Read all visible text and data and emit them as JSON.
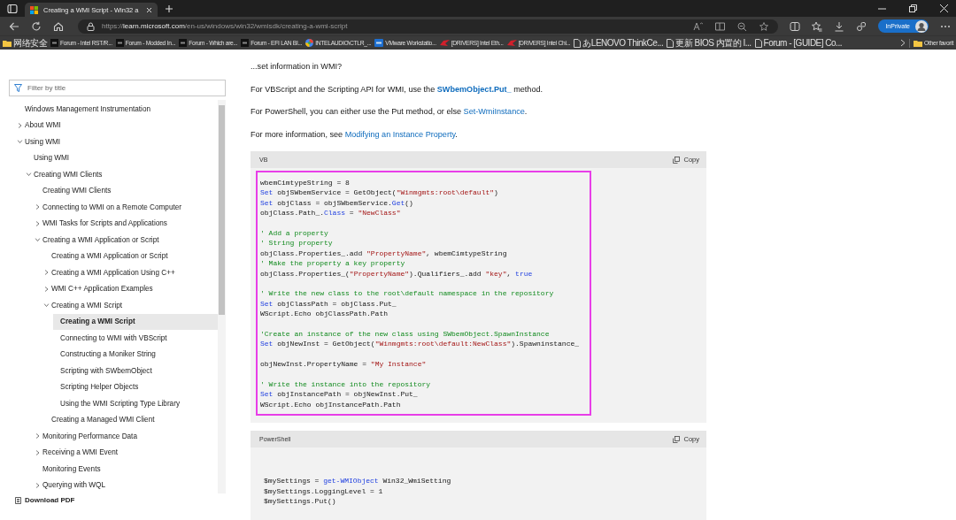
{
  "browser": {
    "tab": {
      "title": "Creating a WMI Script - Win32 a",
      "selected": true
    },
    "address": {
      "prefix": "https://",
      "host": "learn.microsoft.com",
      "path": "/en-us/windows/win32/wmisdk/creating-a-wmi-script"
    },
    "inprivate": "InPrivate",
    "bookmarks": [
      {
        "kind": "folder",
        "label": "网络安全"
      },
      {
        "kind": "forum",
        "label": "Forum - Intel RST/R..."
      },
      {
        "kind": "forum",
        "label": "Forum - Modded In..."
      },
      {
        "kind": "forum",
        "label": "Forum - Which are..."
      },
      {
        "kind": "forum",
        "label": "Forum - EFI LAN BI..."
      },
      {
        "kind": "swirl",
        "label": "INTELAUDIO\\CTLR_..."
      },
      {
        "kind": "vmware",
        "label": "VMware Workstatio..."
      },
      {
        "kind": "rog",
        "label": "[DRIVERS] Intel Eth..."
      },
      {
        "kind": "rog",
        "label": "[DRIVERS] Intel Chi..."
      },
      {
        "kind": "page",
        "label": "あLENOVO ThinkCe..."
      },
      {
        "kind": "page",
        "label": "更新 BIOS 内置的 I..."
      },
      {
        "kind": "page",
        "label": "Forum - [GUIDE] Co..."
      }
    ],
    "other_favorites": "Other favorit"
  },
  "sidebar": {
    "filter": {
      "placeholder": "Filter by title"
    },
    "tree": [
      {
        "label": "Windows Management Instrumentation",
        "selected": false
      },
      {
        "label": "About WMI",
        "selected": false,
        "expanded": false
      },
      {
        "label": "Using WMI",
        "selected": false,
        "expanded": true,
        "children": [
          {
            "label": "Using WMI",
            "selected": false
          },
          {
            "label": "Creating WMI Clients",
            "selected": false,
            "expanded": true,
            "children": [
              {
                "label": "Creating WMI Clients",
                "selected": false
              },
              {
                "label": "Connecting to WMI on a Remote Computer",
                "selected": false,
                "expanded": false
              },
              {
                "label": "WMI Tasks for Scripts and Applications",
                "selected": false,
                "expanded": false
              },
              {
                "label": "Creating a WMI Application or Script",
                "selected": false,
                "expanded": true,
                "children": [
                  {
                    "label": "Creating a WMI Application or Script",
                    "selected": false
                  },
                  {
                    "label": "Creating a WMI Application Using C++",
                    "selected": false,
                    "expanded": false
                  },
                  {
                    "label": "WMI C++ Application Examples",
                    "selected": false,
                    "expanded": false
                  },
                  {
                    "label": "Creating a WMI Script",
                    "selected": false,
                    "expanded": true,
                    "children": [
                      {
                        "label": "Creating a WMI Script",
                        "selected": true
                      },
                      {
                        "label": "Connecting to WMI with VBScript",
                        "selected": false
                      },
                      {
                        "label": "Constructing a Moniker String",
                        "selected": false
                      },
                      {
                        "label": "Scripting with SWbemObject",
                        "selected": false
                      },
                      {
                        "label": "Scripting Helper Objects",
                        "selected": false
                      },
                      {
                        "label": "Using the WMI Scripting Type Library",
                        "selected": false
                      }
                    ]
                  },
                  {
                    "label": "Creating a Managed WMI Client",
                    "selected": false
                  }
                ]
              },
              {
                "label": "Monitoring Performance Data",
                "selected": false,
                "expanded": false
              },
              {
                "label": "Receiving a WMI Event",
                "selected": false,
                "expanded": false
              },
              {
                "label": "Monitoring Events",
                "selected": false
              },
              {
                "label": "Querying with WQL",
                "selected": false,
                "expanded": false
              }
            ]
          }
        ]
      }
    ],
    "download": "Download PDF"
  },
  "article": {
    "paragraphs": [
      [
        {
          "kind": "plain",
          "text": "...set information in WMI?"
        }
      ],
      [
        {
          "kind": "plain",
          "text": "For VBScript and the Scripting API for WMI, use the "
        },
        {
          "kind": "strong-link",
          "text": "SWbemObject.Put_"
        },
        {
          "kind": "plain",
          "text": " method."
        }
      ],
      [
        {
          "kind": "plain",
          "text": "For PowerShell, you can either use the Put method, or else "
        },
        {
          "kind": "link",
          "text": "Set-WmiInstance"
        },
        {
          "kind": "plain",
          "text": "."
        }
      ],
      [
        {
          "kind": "plain",
          "text": "For more information, see "
        },
        {
          "kind": "link",
          "text": "Modifying an Instance Property"
        },
        {
          "kind": "plain",
          "text": "."
        }
      ]
    ],
    "code_blocks": [
      {
        "language": "VB",
        "copy": "Copy",
        "highlighted": true,
        "blocks": [
          [
            [
              {
                "kind": "plain",
                "text": "wbemCimtypeString = 8"
              }
            ],
            [
              {
                "kind": "kw",
                "text": "Set"
              },
              {
                "kind": "plain",
                "text": " objSWbemService = GetObject("
              },
              {
                "kind": "str",
                "text": "\"Winmgmts:root\\default\""
              },
              {
                "kind": "plain",
                "text": ")"
              }
            ],
            [
              {
                "kind": "kw",
                "text": "Set"
              },
              {
                "kind": "plain",
                "text": " objClass = objSWbemService."
              },
              {
                "kind": "kw",
                "text": "Get"
              },
              {
                "kind": "plain",
                "text": "()"
              }
            ],
            [
              {
                "kind": "plain",
                "text": "objClass.Path_."
              },
              {
                "kind": "kw",
                "text": "Class"
              },
              {
                "kind": "plain",
                "text": " = "
              },
              {
                "kind": "str",
                "text": "\"NewClass\""
              }
            ]
          ],
          [
            [
              {
                "kind": "cmt",
                "text": "' Add a property"
              }
            ],
            [
              {
                "kind": "cmt",
                "text": "' String property"
              }
            ],
            [
              {
                "kind": "plain",
                "text": "objClass.Properties_.add "
              },
              {
                "kind": "str",
                "text": "\"PropertyName\""
              },
              {
                "kind": "plain",
                "text": ", wbemCimtypeString"
              }
            ],
            [
              {
                "kind": "cmt",
                "text": "' Make the property a key property"
              }
            ],
            [
              {
                "kind": "plain",
                "text": "objClass.Properties_("
              },
              {
                "kind": "str",
                "text": "\"PropertyName\""
              },
              {
                "kind": "plain",
                "text": ").Qualifiers_.add "
              },
              {
                "kind": "str",
                "text": "\"key\""
              },
              {
                "kind": "plain",
                "text": ", "
              },
              {
                "kind": "kw",
                "text": "true"
              }
            ]
          ],
          [
            [
              {
                "kind": "cmt",
                "text": "' Write the new class to the root\\default namespace in the repository"
              }
            ],
            [
              {
                "kind": "kw",
                "text": "Set"
              },
              {
                "kind": "plain",
                "text": " objClassPath = objClass.Put_"
              }
            ],
            [
              {
                "kind": "plain",
                "text": "WScript.Echo objClassPath.Path"
              }
            ]
          ],
          [
            [
              {
                "kind": "cmt",
                "text": "'Create an instance of the new class using SWbemObject.SpawnInstance"
              }
            ],
            [
              {
                "kind": "kw",
                "text": "Set"
              },
              {
                "kind": "plain",
                "text": " objNewInst = GetObject("
              },
              {
                "kind": "str",
                "text": "\"Winmgmts:root\\default:NewClass\""
              },
              {
                "kind": "plain",
                "text": ").Spawninstance_"
              }
            ]
          ],
          [
            [
              {
                "kind": "plain",
                "text": "objNewInst.PropertyName = "
              },
              {
                "kind": "str",
                "text": "\"My Instance\""
              }
            ]
          ],
          [
            [
              {
                "kind": "cmt",
                "text": "' Write the instance into the repository"
              }
            ],
            [
              {
                "kind": "kw",
                "text": "Set"
              },
              {
                "kind": "plain",
                "text": " objInstancePath = objNewInst.Put_"
              }
            ],
            [
              {
                "kind": "plain",
                "text": "WScript.Echo objInstancePath.Path"
              }
            ]
          ]
        ]
      },
      {
        "language": "PowerShell",
        "copy": "Copy",
        "highlighted": false,
        "blocks": [
          [
            [
              {
                "kind": "plain",
                "text": "$mySettings = "
              },
              {
                "kind": "kw",
                "text": "get-WMIObject"
              },
              {
                "kind": "plain",
                "text": " Win32_WmiSetting"
              }
            ],
            [
              {
                "kind": "plain",
                "text": "$mySettings.LoggingLevel = 1"
              }
            ],
            [
              {
                "kind": "plain",
                "text": "$mySettings.Put()"
              }
            ]
          ]
        ]
      }
    ]
  }
}
